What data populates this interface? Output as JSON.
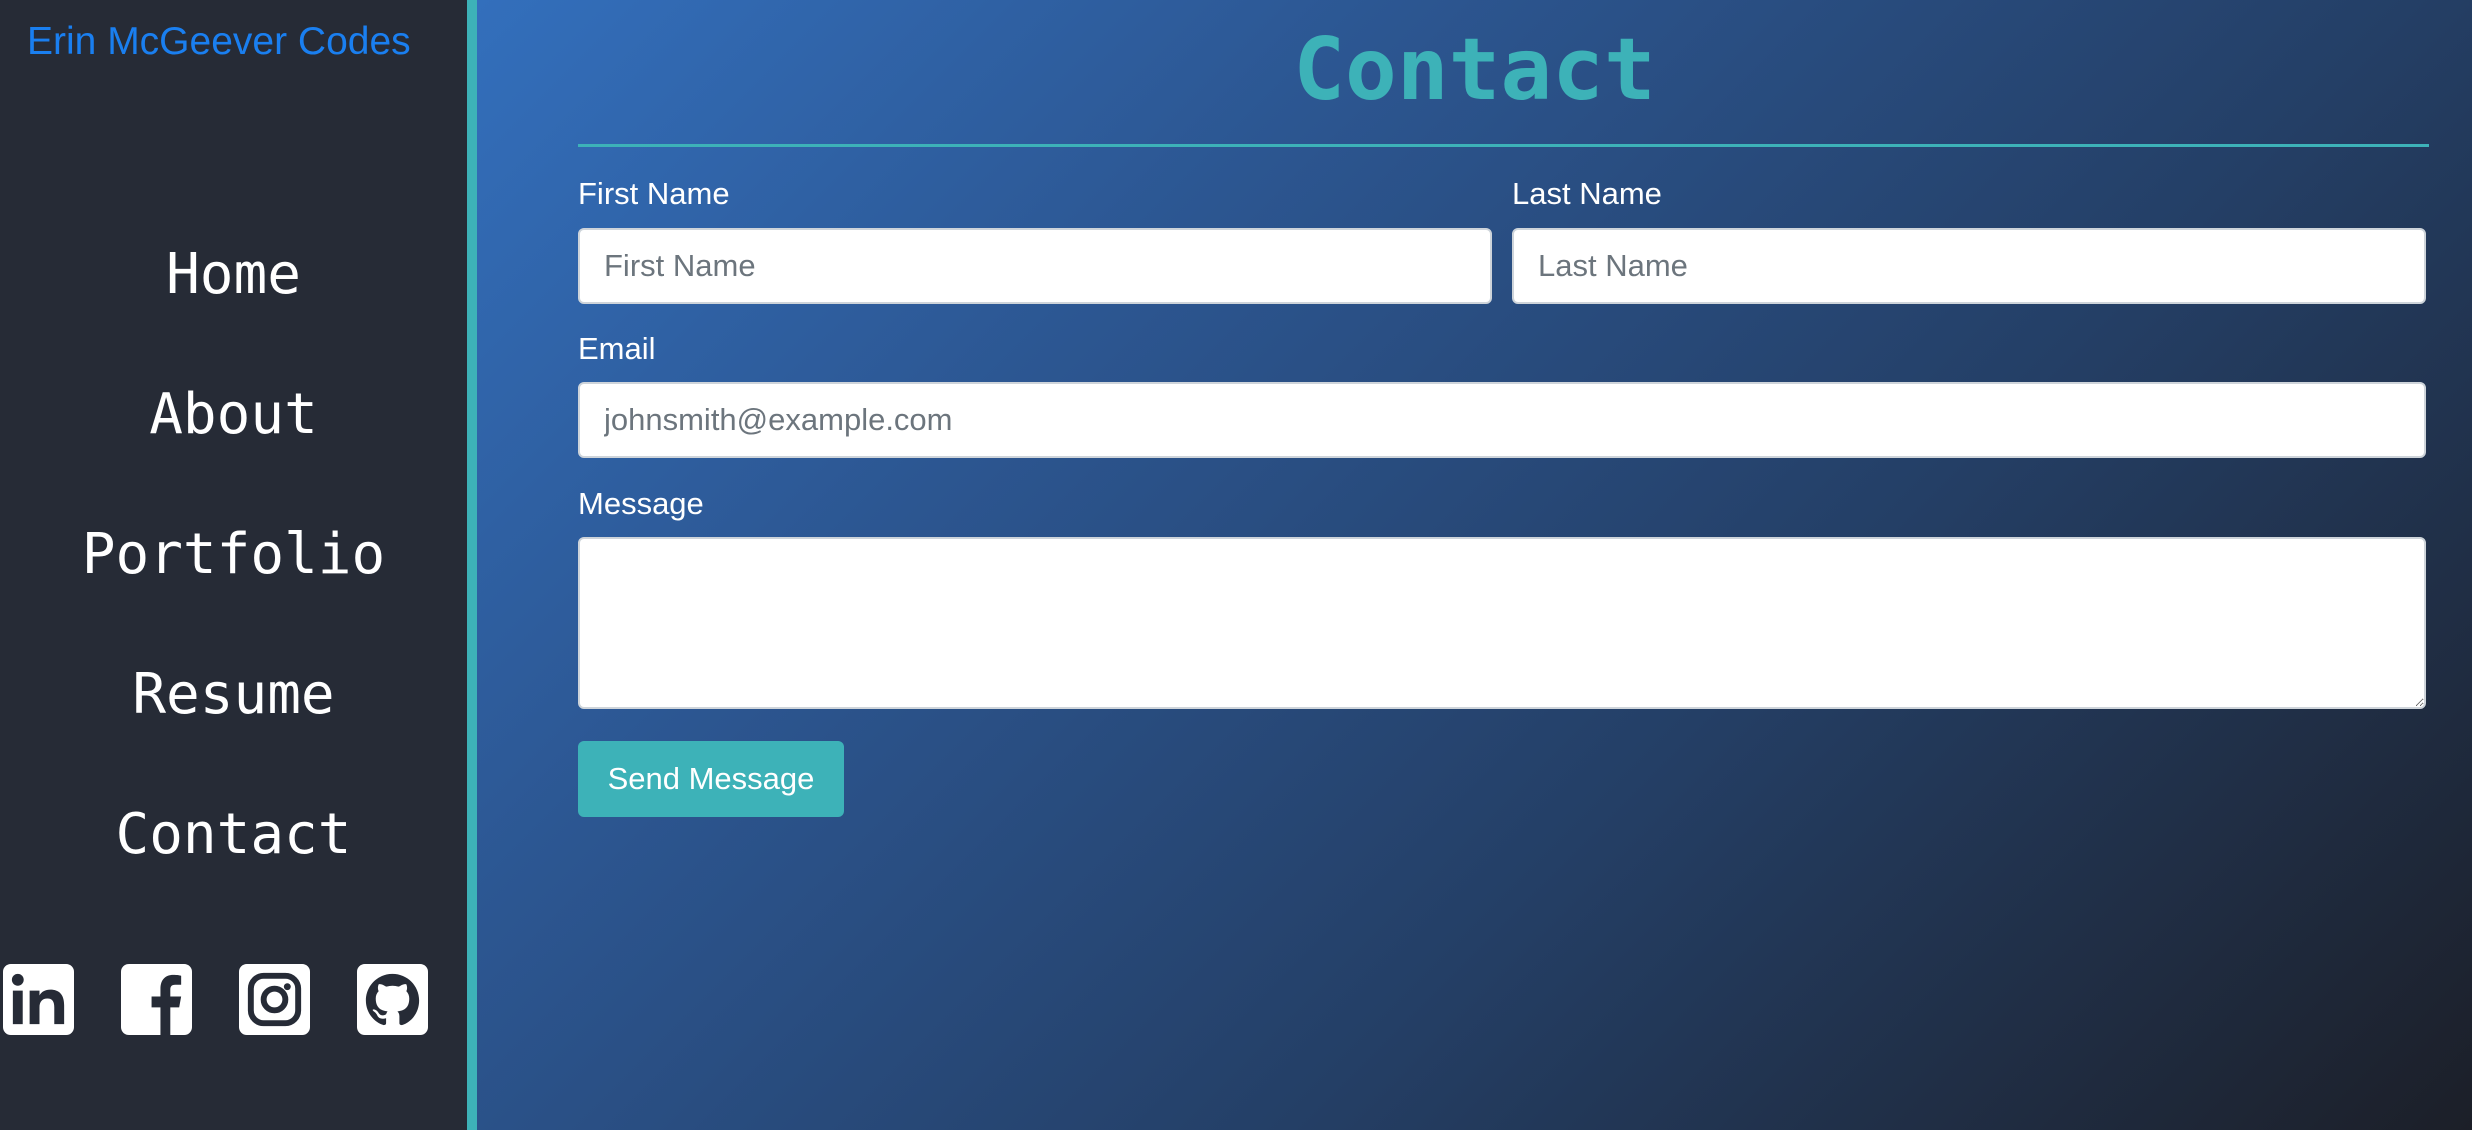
{
  "sidebar": {
    "brand": "Erin McGeever Codes",
    "brand_color": "#1a7ff0",
    "nav": [
      {
        "label": "Home"
      },
      {
        "label": "About"
      },
      {
        "label": "Portfolio"
      },
      {
        "label": "Resume"
      },
      {
        "label": "Contact"
      }
    ],
    "social": [
      {
        "icon": "linkedin-icon"
      },
      {
        "icon": "facebook-icon"
      },
      {
        "icon": "instagram-icon"
      },
      {
        "icon": "github-icon"
      }
    ],
    "accent_color": "#3db2b8",
    "background_color": "#262b36"
  },
  "main": {
    "title": "Contact",
    "form": {
      "first_name": {
        "label": "First Name",
        "placeholder": "First Name",
        "value": ""
      },
      "last_name": {
        "label": "Last Name",
        "placeholder": "Last Name",
        "value": ""
      },
      "email": {
        "label": "Email",
        "placeholder": "johnsmith@example.com",
        "value": ""
      },
      "message": {
        "label": "Message",
        "placeholder": "",
        "value": ""
      },
      "submit_label": "Send Message"
    }
  }
}
